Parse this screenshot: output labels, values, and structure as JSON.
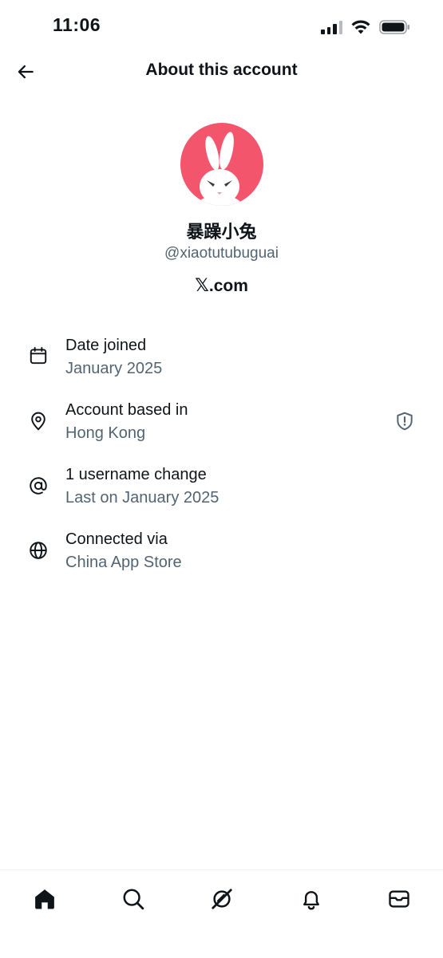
{
  "status_bar": {
    "time": "11:06"
  },
  "header": {
    "title": "About this account",
    "back_icon": "arrow-left-icon"
  },
  "profile": {
    "display_name": "暴躁小兔",
    "handle": "@xiaotutubuguai",
    "brand_glyph": "𝕏",
    "brand_text": ".com",
    "avatar_bg": "#f3566c"
  },
  "info": {
    "date_joined": {
      "label": "Date joined",
      "value": "January 2025",
      "icon": "calendar-icon"
    },
    "based_in": {
      "label": "Account based in",
      "value": "Hong Kong",
      "icon": "location-pin-icon",
      "action_icon": "shield-alert-icon"
    },
    "username": {
      "label": "1 username change",
      "value": "Last on January 2025",
      "icon": "at-sign-icon"
    },
    "connected": {
      "label": "Connected via",
      "value": "China App Store",
      "icon": "globe-icon"
    }
  },
  "bottom_nav": [
    "home-icon",
    "search-icon",
    "grok-icon",
    "notifications-icon",
    "messages-icon"
  ],
  "colors": {
    "text": "#0f1419",
    "secondary": "#536471",
    "accent_avatar": "#f3566c"
  }
}
